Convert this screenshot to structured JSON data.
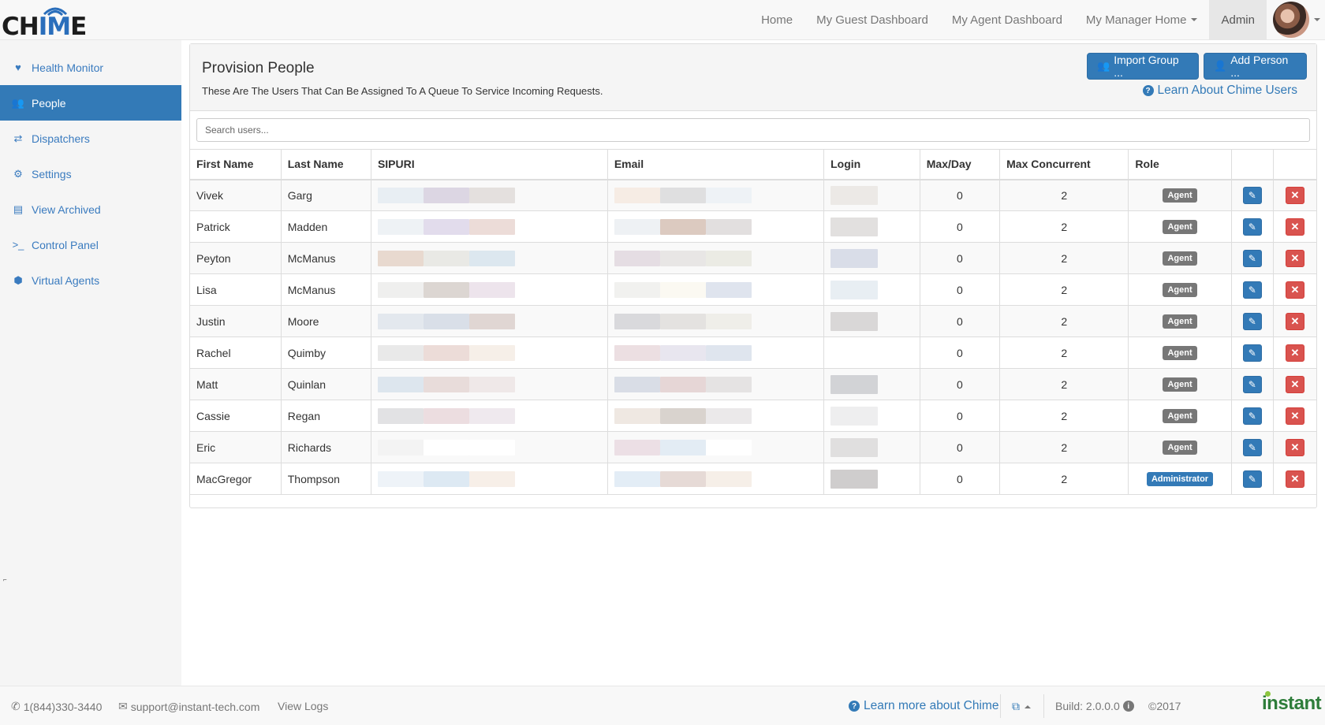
{
  "app": {
    "logo_text_pre": "CH",
    "logo_text_hi": "IM",
    "logo_text_post": "E"
  },
  "nav": {
    "items": [
      {
        "label": "Home"
      },
      {
        "label": "My Guest Dashboard"
      },
      {
        "label": "My Agent Dashboard"
      },
      {
        "label": "My Manager Home"
      },
      {
        "label": "Admin"
      }
    ]
  },
  "sidebar": {
    "items": [
      {
        "label": "Health Monitor",
        "icon": "heartbeat-icon"
      },
      {
        "label": "People",
        "icon": "users-icon",
        "active": true
      },
      {
        "label": "Dispatchers",
        "icon": "exchange-icon"
      },
      {
        "label": "Settings",
        "icon": "cogs-icon"
      },
      {
        "label": "View Archived",
        "icon": "archive-icon"
      },
      {
        "label": "Control Panel",
        "icon": "terminal-icon"
      },
      {
        "label": "Virtual Agents",
        "icon": "android-icon"
      }
    ]
  },
  "panel": {
    "title": "Provision People",
    "subtitle": "These Are The Users That Can Be Assigned To A Queue To Service Incoming Requests.",
    "import_button": "Import Group ...",
    "add_button": "Add Person ...",
    "learn_link": "Learn About Chime Users",
    "search_placeholder": "Search users..."
  },
  "table": {
    "headers": [
      "First Name",
      "Last Name",
      "SIPURI",
      "Email",
      "Login",
      "Max/Day",
      "Max Concurrent",
      "Role",
      "",
      ""
    ],
    "rows": [
      {
        "first": "Vivek",
        "last": "Garg",
        "max_day": "0",
        "max_concurrent": "2",
        "role": "Agent"
      },
      {
        "first": "Patrick",
        "last": "Madden",
        "max_day": "0",
        "max_concurrent": "2",
        "role": "Agent"
      },
      {
        "first": "Peyton",
        "last": "McManus",
        "max_day": "0",
        "max_concurrent": "2",
        "role": "Agent"
      },
      {
        "first": "Lisa",
        "last": "McManus",
        "max_day": "0",
        "max_concurrent": "2",
        "role": "Agent"
      },
      {
        "first": "Justin",
        "last": "Moore",
        "max_day": "0",
        "max_concurrent": "2",
        "role": "Agent"
      },
      {
        "first": "Rachel",
        "last": "Quimby",
        "max_day": "0",
        "max_concurrent": "2",
        "role": "Agent"
      },
      {
        "first": "Matt",
        "last": "Quinlan",
        "max_day": "0",
        "max_concurrent": "2",
        "role": "Agent"
      },
      {
        "first": "Cassie",
        "last": "Regan",
        "max_day": "0",
        "max_concurrent": "2",
        "role": "Agent"
      },
      {
        "first": "Eric",
        "last": "Richards",
        "max_day": "0",
        "max_concurrent": "2",
        "role": "Agent"
      },
      {
        "first": "MacGregor",
        "last": "Thompson",
        "max_day": "0",
        "max_concurrent": "2",
        "role": "Administrator"
      }
    ]
  },
  "footer": {
    "phone": "1(844)330-3440",
    "email": "support@instant-tech.com",
    "view_logs": "View Logs",
    "learn_more": "Learn more about Chime",
    "build": "Build: 2.0.0.0",
    "copyright": "©2017",
    "brand": "instant"
  },
  "colors": {
    "primary": "#337ab7",
    "danger": "#d9534f",
    "badge_default": "#777777",
    "brand_green": "#2e7d3a"
  }
}
